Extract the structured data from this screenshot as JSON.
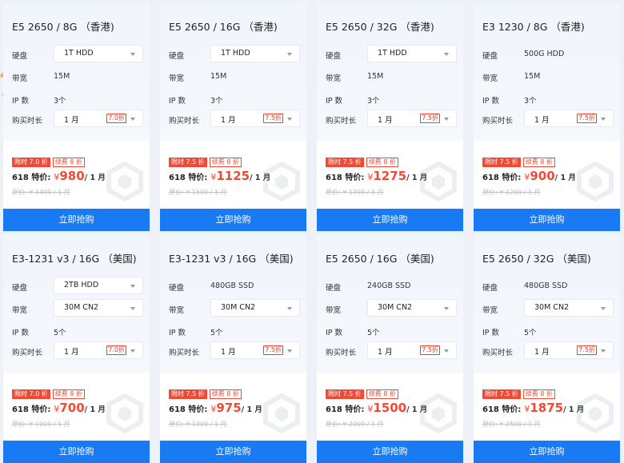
{
  "colors": {
    "accent": "#1a7af4",
    "price": "#f04a36"
  },
  "labels": {
    "disk": "硬盘",
    "bandwidth": "带宽",
    "ip": "IP 数",
    "duration": "购买时长",
    "special": "618 特价:",
    "yen": "¥",
    "per_month": "/ 1 月",
    "buy": "立即抢购",
    "badge_renew": "续费 8 折"
  },
  "cards": [
    {
      "title": "E5 2650 / 8G （香港)",
      "disk": "1T HDD",
      "disk_select": true,
      "bandwidth": "15M",
      "bw_select": false,
      "ip": "3个",
      "months": "1 月",
      "disc": "7.0折",
      "limit": "限时 7.0 折",
      "price": "980",
      "orig": "原价: ¥ 1400 / 1 月"
    },
    {
      "title": "E5 2650 / 16G （香港)",
      "disk": "1T HDD",
      "disk_select": true,
      "bandwidth": "15M",
      "bw_select": false,
      "ip": "3个",
      "months": "1 月",
      "disc": "7.5折",
      "limit": "限时 7.5 折",
      "price": "1125",
      "orig": "原价: ¥ 1500 / 1 月"
    },
    {
      "title": "E5 2650 / 32G （香港)",
      "disk": "1T HDD",
      "disk_select": true,
      "bandwidth": "15M",
      "bw_select": false,
      "ip": "3个",
      "months": "1 月",
      "disc": "7.5折",
      "limit": "限时 7.5 折",
      "price": "1275",
      "orig": "原价: ¥ 1700 / 1 月"
    },
    {
      "title": "E3 1230 / 8G （香港)",
      "disk": "500G HDD",
      "disk_select": false,
      "bandwidth": "15M",
      "bw_select": false,
      "ip": "3个",
      "months": "1 月",
      "disc": "7.5折",
      "limit": "限时 7.5 折",
      "price": "900",
      "orig": "原价: ¥ 1200 / 1 月"
    },
    {
      "title": "E3-1231 v3 / 16G （美国)",
      "disk": "2TB HDD",
      "disk_select": true,
      "bandwidth": "30M CN2",
      "bw_select": true,
      "ip": "5个",
      "months": "1 月",
      "disc": "7.0折",
      "limit": "限时 7.0 折",
      "price": "700",
      "orig": "原价: ¥ 1000 / 1 月"
    },
    {
      "title": "E3-1231 v3 / 16G （美国)",
      "disk": "480GB SSD",
      "disk_select": false,
      "bandwidth": "30M CN2",
      "bw_select": true,
      "ip": "5个",
      "months": "1 月",
      "disc": "7.5折",
      "limit": "限时 7.5 折",
      "price": "975",
      "orig": "原价: ¥ 1300 / 1 月"
    },
    {
      "title": "E5 2650 / 16G （美国)",
      "disk": "240GB SSD",
      "disk_select": false,
      "bandwidth": "30M CN2",
      "bw_select": true,
      "ip": "5个",
      "months": "1 月",
      "disc": "7.5折",
      "limit": "限时 7.5 折",
      "price": "1500",
      "orig": "原价: ¥ 2000 / 1 月"
    },
    {
      "title": "E5 2650 / 32G （美国)",
      "disk": "480GB SSD",
      "disk_select": false,
      "bandwidth": "30M CN2",
      "bw_select": true,
      "ip": "5个",
      "months": "1 月",
      "disc": "7.5折",
      "limit": "限时 7.5 折",
      "price": "1875",
      "orig": "原价: ¥ 2500 / 1 月"
    }
  ]
}
